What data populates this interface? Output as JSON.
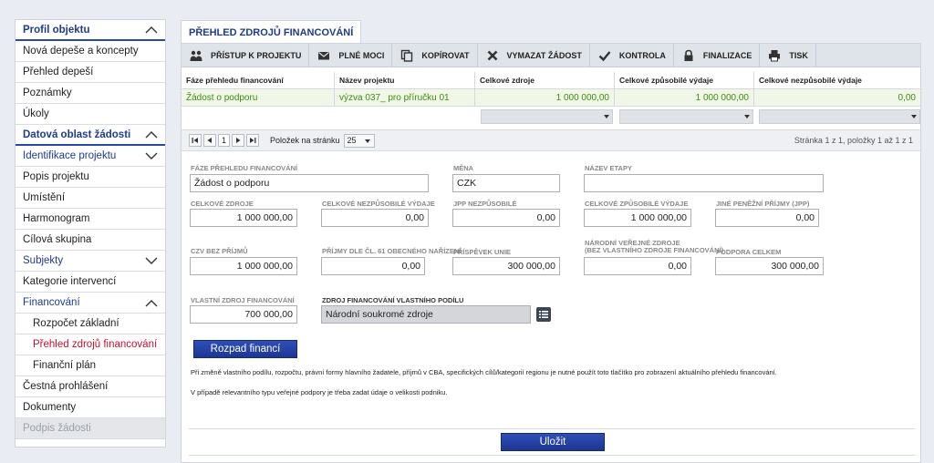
{
  "sidebar": {
    "items": [
      {
        "label": "Profil objektu",
        "kind": "section",
        "chevron": "up"
      },
      {
        "label": "Nová depeše a koncepty",
        "kind": "item"
      },
      {
        "label": "Přehled depeší",
        "kind": "item"
      },
      {
        "label": "Poznámky",
        "kind": "item"
      },
      {
        "label": "Úkoly",
        "kind": "item"
      },
      {
        "label": "Datová oblast žádosti",
        "kind": "section",
        "chevron": "up"
      },
      {
        "label": "Identifikace projektu",
        "kind": "group",
        "chevron": "down"
      },
      {
        "label": "Popis projektu",
        "kind": "item"
      },
      {
        "label": "Umístění",
        "kind": "item"
      },
      {
        "label": "Harmonogram",
        "kind": "item"
      },
      {
        "label": "Cílová skupina",
        "kind": "item"
      },
      {
        "label": "Subjekty",
        "kind": "group",
        "chevron": "down"
      },
      {
        "label": "Kategorie intervencí",
        "kind": "item"
      },
      {
        "label": "Financování",
        "kind": "group",
        "chevron": "up"
      },
      {
        "label": "Rozpočet základní",
        "kind": "sub"
      },
      {
        "label": "Přehled zdrojů financování",
        "kind": "sub-active"
      },
      {
        "label": "Finanční plán",
        "kind": "sub"
      },
      {
        "label": "Čestná prohlášení",
        "kind": "item"
      },
      {
        "label": "Dokumenty",
        "kind": "item"
      },
      {
        "label": "Podpis žádosti",
        "kind": "disabled"
      }
    ]
  },
  "tab": {
    "title": "PŘEHLED ZDROJŮ FINANCOVÁNÍ"
  },
  "toolbar": {
    "buttons": [
      {
        "label": "PŘÍSTUP K PROJEKTU",
        "icon": "users-icon"
      },
      {
        "label": "PLNÉ MOCI",
        "icon": "envelope-icon"
      },
      {
        "label": "KOPÍROVAT",
        "icon": "copy-icon"
      },
      {
        "label": "VYMAZAT ŽÁDOST",
        "icon": "cross-icon"
      },
      {
        "label": "KONTROLA",
        "icon": "check-icon"
      },
      {
        "label": "FINALIZACE",
        "icon": "lock-icon"
      },
      {
        "label": "TISK",
        "icon": "printer-icon"
      }
    ]
  },
  "grid": {
    "headers": [
      "Fáze přehledu financování",
      "Název projektu",
      "Celkové zdroje",
      "Celkové způsobilé výdaje",
      "Celkové nezpůsobilé výdaje"
    ],
    "rows": [
      [
        "Žádost o podporu",
        "výzva 037_ pro příručku 01",
        "1 000 000,00",
        "1 000 000,00",
        "0,00"
      ]
    ]
  },
  "pager": {
    "page": "1",
    "per_page_label": "Položek na stránku",
    "per_page": "25",
    "info": "Stránka 1 z 1, položky 1 až 1 z 1"
  },
  "form": {
    "faze_label": "FÁZE PŘEHLEDU FINANCOVÁNÍ",
    "faze_value": "Žádost o podporu",
    "mena_label": "MĚNA",
    "mena_value": "CZK",
    "etapa_label": "NÁZEV ETAPY",
    "etapa_value": "",
    "celk_zdroje_label": "CELKOVÉ ZDROJE",
    "celk_zdroje_value": "1 000 000,00",
    "nezpus_label": "CELKOVÉ NEZPŮSOBILÉ VÝDAJE",
    "nezpus_value": "0,00",
    "jpp_nezpus_label": "JPP NEZPŮSOBILÉ",
    "jpp_nezpus_value": "0,00",
    "zpus_label": "CELKOVÉ ZPŮSOBILÉ VÝDAJE",
    "zpus_value": "1 000 000,00",
    "jine_label": "JINÉ PENĚŽNÍ PŘÍJMY (JPP)",
    "jine_value": "0,00",
    "czv_label": "CZV BEZ PŘÍJMŮ",
    "czv_value": "1 000 000,00",
    "prijmy61_label": "PŘÍJMY DLE ČL. 61 OBECNÉHO NAŘÍZENÍ",
    "prijmy61_value": "0,00",
    "unie_label": "PŘÍSPĚVEK UNIE",
    "unie_value": "300 000,00",
    "narodni_label_1": "NÁRODNÍ VEŘEJNÉ ZDROJE",
    "narodni_label_2": "(BEZ VLASTNÍHO ZDROJE FINANCOVÁNÍ)",
    "narodni_value": "0,00",
    "podpora_label": "PODPORA CELKEM",
    "podpora_value": "300 000,00",
    "vlastni_label": "VLASTNÍ ZDROJ FINANCOVÁNÍ",
    "vlastni_value": "700 000,00",
    "zdroj_vl_label": "ZDROJ FINANCOVÁNÍ VLASTNÍHO PODÍLU",
    "zdroj_vl_value": "Národní soukromé zdroje",
    "rozpad_button": "Rozpad financí",
    "note1": "Při změně vlastního podílu, rozpočtu, právní formy hlavního žadatele, příjmů v CBA, specifických cílů/kategorií regionu je nutné použít toto tlačítko pro zobrazení aktuálního přehledu financování.",
    "note2": "V případě relevantního typu veřejné podpory je třeba zadat údaje o velikosti podniku.",
    "save_button": "Uložit"
  },
  "colors": {
    "accent": "#1f3a8f",
    "active": "#c8102e",
    "green_text": "#3f8a14",
    "green_row": "#f0f7e6"
  }
}
